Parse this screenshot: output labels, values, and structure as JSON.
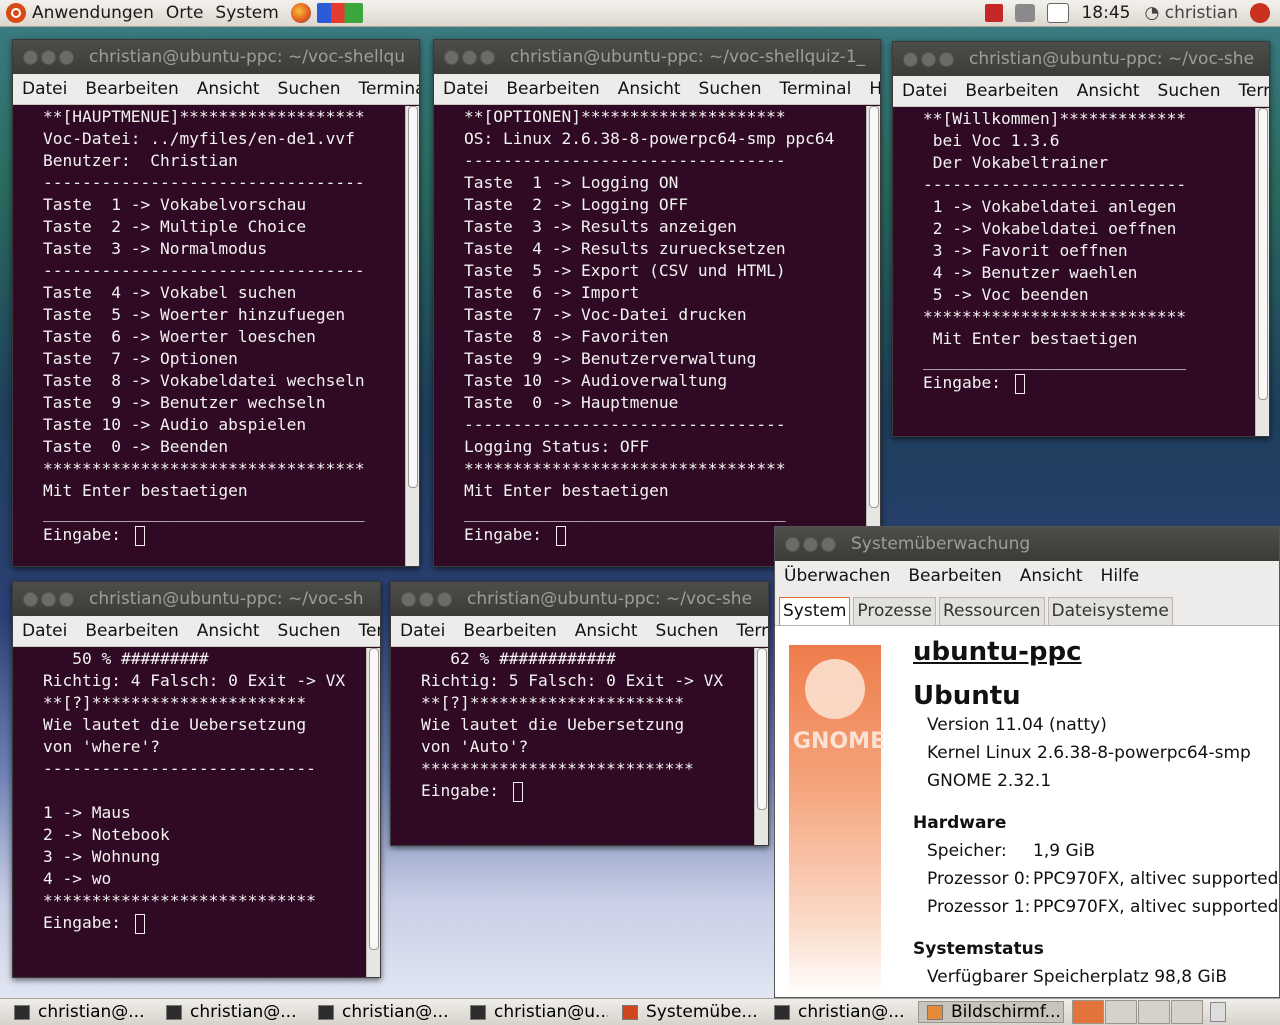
{
  "top_panel": {
    "menus": [
      "Anwendungen",
      "Orte",
      "System"
    ],
    "clock": "18:45",
    "user": "christian"
  },
  "windows": [
    {
      "title": "christian@ubuntu-ppc: ~/voc-shellqu",
      "menu": [
        "Datei",
        "Bearbeiten",
        "Ansicht",
        "Suchen",
        "Terminal"
      ],
      "lines": [
        "**[HAUPTMENUE]*******************",
        "Voc-Datei: ../myfiles/en-de1.vvf",
        "Benutzer:  Christian",
        "---------------------------------",
        "Taste  1 -> Vokabelvorschau",
        "Taste  2 -> Multiple Choice",
        "Taste  3 -> Normalmodus",
        "---------------------------------",
        "Taste  4 -> Vokabel suchen",
        "Taste  5 -> Woerter hinzufuegen",
        "Taste  6 -> Woerter loeschen",
        "Taste  7 -> Optionen",
        "Taste  8 -> Vokabeldatei wechseln",
        "Taste  9 -> Benutzer wechseln",
        "Taste 10 -> Audio abspielen",
        "Taste  0 -> Beenden",
        "*********************************",
        "Mit Enter bestaetigen",
        "_________________________________",
        "Eingabe: "
      ]
    },
    {
      "title": "christian@ubuntu-ppc: ~/voc-shellquiz-1_",
      "menu": [
        "Datei",
        "Bearbeiten",
        "Ansicht",
        "Suchen",
        "Terminal",
        "Hilfe"
      ],
      "lines": [
        "**[OPTIONEN]*********************",
        "OS: Linux 2.6.38-8-powerpc64-smp ppc64",
        "---------------------------------",
        "Taste  1 -> Logging ON",
        "Taste  2 -> Logging OFF",
        "Taste  3 -> Results anzeigen",
        "Taste  4 -> Results zuruecksetzen",
        "Taste  5 -> Export (CSV und HTML)",
        "Taste  6 -> Import",
        "Taste  7 -> Voc-Datei drucken",
        "Taste  8 -> Favoriten",
        "Taste  9 -> Benutzerverwaltung",
        "Taste 10 -> Audioverwaltung",
        "Taste  0 -> Hauptmenue",
        "---------------------------------",
        "Logging Status: OFF",
        "*********************************",
        "Mit Enter bestaetigen",
        "_________________________________",
        "Eingabe: "
      ]
    },
    {
      "title": "christian@ubuntu-ppc: ~/voc-she",
      "menu": [
        "Datei",
        "Bearbeiten",
        "Ansicht",
        "Suchen",
        "Termin"
      ],
      "lines": [
        "**[Willkommen]*************",
        " bei Voc 1.3.6",
        " Der Vokabeltrainer",
        "---------------------------",
        " 1 -> Vokabeldatei anlegen",
        " 2 -> Vokabeldatei oeffnen",
        " 3 -> Favorit oeffnen",
        " 4 -> Benutzer waehlen",
        " 5 -> Voc beenden",
        "***************************",
        " Mit Enter bestaetigen",
        "___________________________",
        "Eingabe: "
      ]
    },
    {
      "title": "christian@ubuntu-ppc: ~/voc-sh",
      "menu": [
        "Datei",
        "Bearbeiten",
        "Ansicht",
        "Suchen",
        "Term"
      ],
      "lines": [
        "   50 % #########",
        "Richtig: 4 Falsch: 0 Exit -> VX",
        "**[?]**********************",
        "Wie lautet die Uebersetzung",
        "von 'where'?",
        "----------------------------",
        "",
        "1 -> Maus",
        "2 -> Notebook",
        "3 -> Wohnung",
        "4 -> wo",
        "****************************",
        "Eingabe: "
      ]
    },
    {
      "title": "christian@ubuntu-ppc: ~/voc-she",
      "menu": [
        "Datei",
        "Bearbeiten",
        "Ansicht",
        "Suchen",
        "Termin"
      ],
      "lines": [
        "   62 % ############",
        "Richtig: 5 Falsch: 0 Exit -> VX",
        "**[?]**********************",
        "Wie lautet die Uebersetzung",
        "von 'Auto'?",
        "****************************",
        "Eingabe: "
      ]
    }
  ],
  "sysmon": {
    "title": "Systemüberwachung",
    "menu": [
      "Überwachen",
      "Bearbeiten",
      "Ansicht",
      "Hilfe"
    ],
    "tabs": [
      "System",
      "Prozesse",
      "Ressourcen",
      "Dateisysteme"
    ],
    "gnome_label": "GNOME",
    "hostname": "ubuntu-ppc",
    "distro": "Ubuntu",
    "version": "Version 11.04 (natty)",
    "kernel": "Kernel Linux 2.6.38-8-powerpc64-smp",
    "gnome": "GNOME 2.32.1",
    "hardware_heading": "Hardware",
    "memory_label": "Speicher:",
    "memory_value": "1,9 GiB",
    "cpu0_label": "Prozessor 0:",
    "cpu0_value": "PPC970FX, altivec supported",
    "cpu1_label": "Prozessor 1:",
    "cpu1_value": "PPC970FX, altivec supported",
    "status_heading": "Systemstatus",
    "disk": "Verfügbarer Speicherplatz 98,8 GiB"
  },
  "taskbar": {
    "tasks": [
      "christian@...",
      "christian@...",
      "christian@...",
      "christian@u...",
      "Systemübe...",
      "christian@...",
      "Bildschirmf..."
    ]
  }
}
